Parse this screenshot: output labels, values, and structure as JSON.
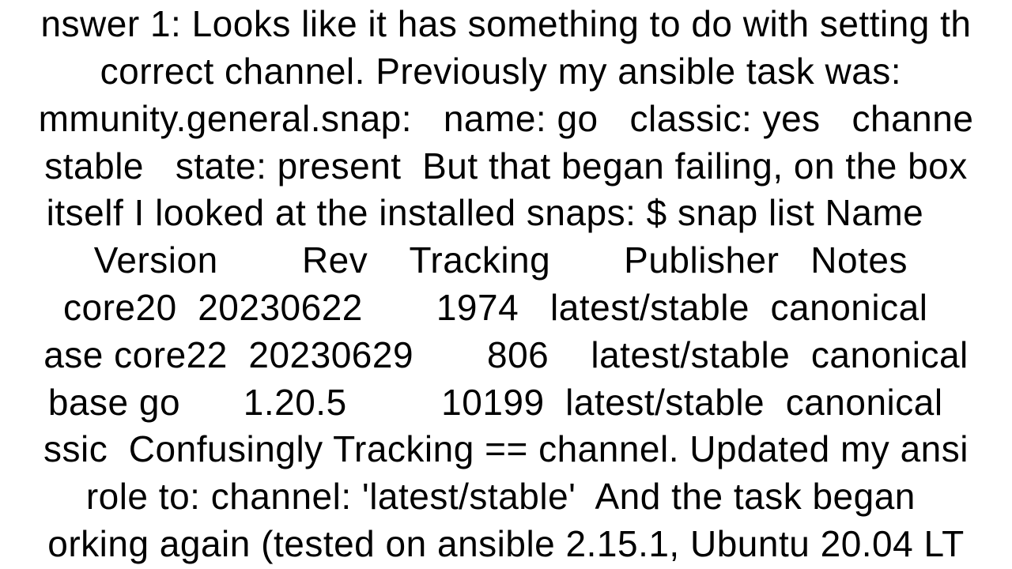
{
  "document": {
    "text": "nswer 1: Looks like it has something to do with setting th\ncorrect channel. Previously my ansible task was: \nmmunity.general.snap:   name: go   classic: yes   channe\nstable   state: present  But that began failing, on the box\nitself I looked at the installed snaps: $ snap list Name    \nVersion        Rev    Tracking       Publisher   Notes \ncore20  20230622       1974   latest/stable  canonical  \nase core22  20230629       806    latest/stable  canonical\nbase go      1.20.5         10199  latest/stable  canonical  \nssic  Confusingly Tracking == channel. Updated my ansi\nrole to: channel: 'latest/stable'  And the task began \norking again (tested on ansible 2.15.1, Ubuntu 20.04 LT"
  }
}
